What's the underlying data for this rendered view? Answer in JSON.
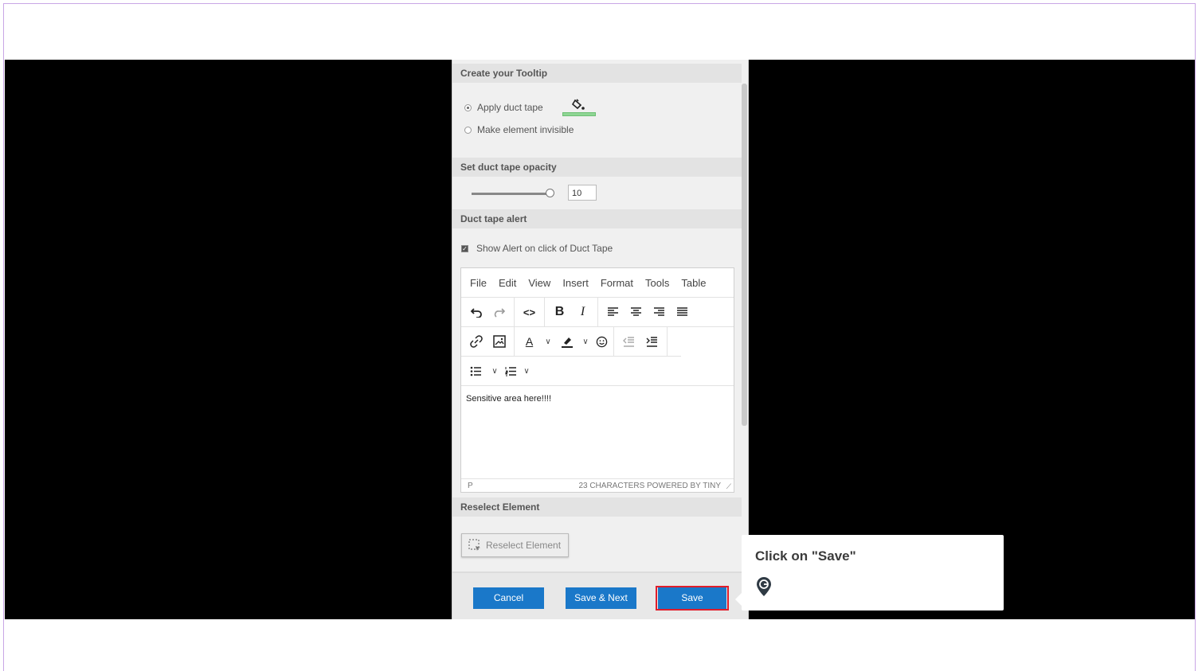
{
  "panel": {
    "tooltip_section": "Create your Tooltip",
    "radio_apply": "Apply duct tape",
    "radio_invisible": "Make element invisible",
    "opacity_section": "Set duct tape opacity",
    "opacity_value": "10",
    "opacity_level": 1.0,
    "alert_section": "Duct tape alert",
    "show_alert_label": "Show Alert on click of Duct Tape",
    "reselect_section": "Reselect Element",
    "reselect_button": "Reselect Element",
    "duct_tape_color": "#8fd694"
  },
  "editor": {
    "menu": [
      "File",
      "Edit",
      "View",
      "Insert",
      "Format",
      "Tools",
      "Table"
    ],
    "content": "Sensitive area here!!!!",
    "status_path": "P",
    "status_right": "23 CHARACTERS  POWERED BY TINY"
  },
  "footer": {
    "cancel": "Cancel",
    "save_next": "Save & Next",
    "save": "Save"
  },
  "callout": {
    "title": "Click on \"Save\"",
    "accent": "#e11d2a",
    "brand_icon": "guide-pin-icon"
  },
  "colors": {
    "button_blue": "#1a78c9",
    "frame_border": "#c9a6e6"
  }
}
